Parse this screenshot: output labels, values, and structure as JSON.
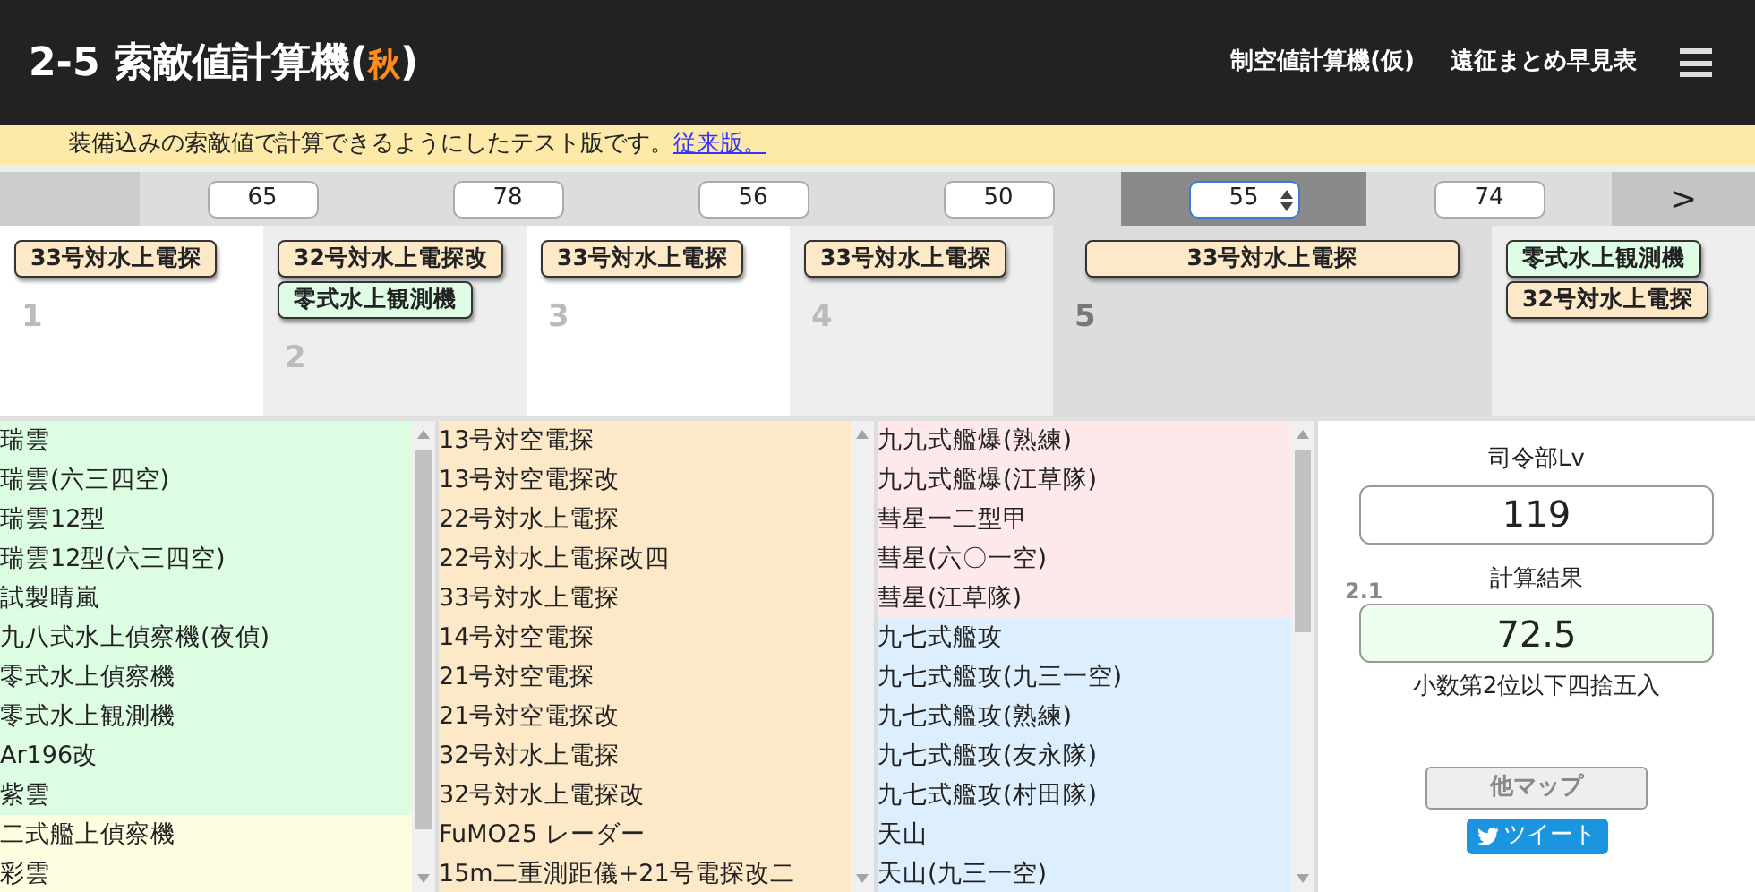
{
  "header": {
    "title_prefix": "2-5 索敵値計算機(",
    "title_highlight": "秋",
    "title_suffix": ")",
    "nav": [
      "制空値計算機(仮)",
      "遠征まとめ早見表"
    ]
  },
  "notice": {
    "text": "装備込みの索敵値で計算できるようにしたテスト版です。",
    "link": "従来版。"
  },
  "fleet_tabs": [
    {
      "value": "65",
      "selected": false
    },
    {
      "value": "78",
      "selected": false
    },
    {
      "value": "56",
      "selected": false
    },
    {
      "value": "50",
      "selected": false
    },
    {
      "value": "55",
      "selected": true
    },
    {
      "value": "74",
      "selected": false
    }
  ],
  "next_button": ">",
  "slots": [
    {
      "number": "1",
      "selected": false,
      "equipment": [
        {
          "name": "33号対水上電探",
          "color": "#fde9c8"
        }
      ]
    },
    {
      "number": "2",
      "selected": false,
      "equipment": [
        {
          "name": "32号対水上電探改",
          "color": "#fde9c8"
        },
        {
          "name": "零式水上観測機",
          "color": "#dffde4"
        }
      ]
    },
    {
      "number": "3",
      "selected": false,
      "equipment": [
        {
          "name": "33号対水上電探",
          "color": "#fde9c8"
        }
      ]
    },
    {
      "number": "4",
      "selected": false,
      "equipment": [
        {
          "name": "33号対水上電探",
          "color": "#fde9c8"
        }
      ]
    },
    {
      "number": "5",
      "selected": true,
      "equipment": [
        {
          "name": "33号対水上電探",
          "color": "#fde9c8"
        }
      ]
    },
    {
      "selected": false,
      "equipment": [
        {
          "name": "零式水上観測機",
          "color": "#dffde4"
        },
        {
          "name": "32号対水上電探",
          "color": "#fde9c8"
        }
      ]
    }
  ],
  "equipment_lists": [
    [
      {
        "name": "瑞雲",
        "color": "#ddfde3"
      },
      {
        "name": "瑞雲(六三四空)",
        "color": "#ddfde3"
      },
      {
        "name": "瑞雲12型",
        "color": "#ddfde3"
      },
      {
        "name": "瑞雲12型(六三四空)",
        "color": "#ddfde3"
      },
      {
        "name": "試製晴嵐",
        "color": "#ddfde3"
      },
      {
        "name": "九八式水上偵察機(夜偵)",
        "color": "#ddfde3"
      },
      {
        "name": "零式水上偵察機",
        "color": "#ddfde3"
      },
      {
        "name": "零式水上観測機",
        "color": "#ddfde3"
      },
      {
        "name": "Ar196改",
        "color": "#ddfde3"
      },
      {
        "name": "紫雲",
        "color": "#ddfde3"
      },
      {
        "name": "二式艦上偵察機",
        "color": "#fffde0"
      },
      {
        "name": "彩雲",
        "color": "#fffde0"
      }
    ],
    [
      {
        "name": "13号対空電探",
        "color": "#fde9c8"
      },
      {
        "name": "13号対空電探改",
        "color": "#fde9c8"
      },
      {
        "name": "22号対水上電探",
        "color": "#fde9c8"
      },
      {
        "name": "22号対水上電探改四",
        "color": "#fde9c8"
      },
      {
        "name": "33号対水上電探",
        "color": "#fde9c8"
      },
      {
        "name": "14号対空電探",
        "color": "#fde9c8"
      },
      {
        "name": "21号対空電探",
        "color": "#fde9c8"
      },
      {
        "name": "21号対空電探改",
        "color": "#fde9c8"
      },
      {
        "name": "32号対水上電探",
        "color": "#fde9c8"
      },
      {
        "name": "32号対水上電探改",
        "color": "#fde9c8"
      },
      {
        "name": "FuMO25 レーダー",
        "color": "#fde9c8"
      },
      {
        "name": "15m二重測距儀+21号電探改二",
        "color": "#fde9c8"
      }
    ],
    [
      {
        "name": "九九式艦爆(熟練)",
        "color": "#fde9ea"
      },
      {
        "name": "九九式艦爆(江草隊)",
        "color": "#fde9ea"
      },
      {
        "name": "彗星一二型甲",
        "color": "#fde9ea"
      },
      {
        "name": "彗星(六〇一空)",
        "color": "#fde9ea"
      },
      {
        "name": "彗星(江草隊)",
        "color": "#fde9ea"
      },
      {
        "name": "九七式艦攻",
        "color": "#ddeefd"
      },
      {
        "name": "九七式艦攻(九三一空)",
        "color": "#ddeefd"
      },
      {
        "name": "九七式艦攻(熟練)",
        "color": "#ddeefd"
      },
      {
        "name": "九七式艦攻(友永隊)",
        "color": "#ddeefd"
      },
      {
        "name": "九七式艦攻(村田隊)",
        "color": "#ddeefd"
      },
      {
        "name": "天山",
        "color": "#ddeefd"
      },
      {
        "name": "天山(九三一空)",
        "color": "#ddeefd"
      }
    ]
  ],
  "result_panel": {
    "hq_label": "司令部Lv",
    "hq_value": "119",
    "result_label": "計算結果",
    "result_badge": "2.1",
    "result_value": "72.5",
    "rounding_note": "小数第2位以下四捨五入",
    "other_maps_button": "他マップ",
    "tweet_button": "ツイート"
  }
}
